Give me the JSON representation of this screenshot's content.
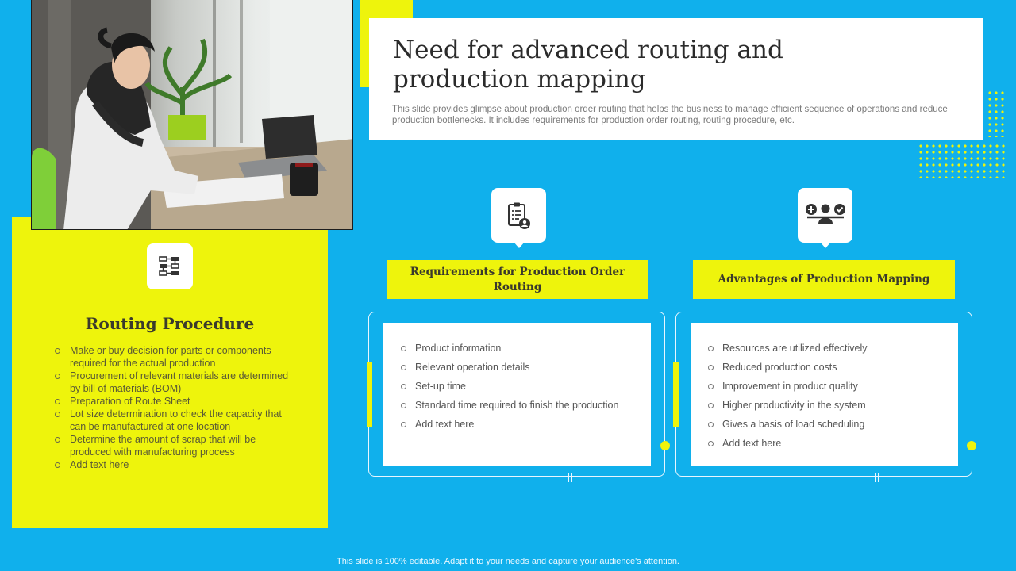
{
  "header": {
    "title": "Need for advanced routing and production mapping",
    "subtitle": "This slide provides glimpse about production order routing that helps the business to manage efficient sequence of operations and reduce production bottlenecks. It includes requirements for production order routing, routing procedure, etc."
  },
  "routing_procedure": {
    "title": "Routing Procedure",
    "icon": "flowchart-icon",
    "items": [
      "Make or buy decision for parts or components required for the actual production",
      "Procurement of relevant materials are determined by bill of materials (BOM)",
      "Preparation of Route Sheet",
      "Lot size determination to check the capacity that can be manufactured at one location",
      "Determine the amount of scrap that will be produced with manufacturing process",
      "Add text here"
    ]
  },
  "requirements": {
    "title": "Requirements for Production Order Routing",
    "icon": "checklist-user-icon",
    "items": [
      "Product information",
      "Relevant operation details",
      "Set-up time",
      "Standard time required to finish the production",
      "Add text here"
    ]
  },
  "advantages": {
    "title": "Advantages of Production Mapping",
    "icon": "person-pros-cons-icon",
    "items": [
      "Resources are utilized effectively",
      "Reduced production costs",
      "Improvement in product quality",
      "Higher productivity in the system",
      "Gives a basis of load scheduling",
      "Add text here"
    ]
  },
  "footer": {
    "text": "This slide is 100% editable. Adapt it to your needs and capture your audience's attention."
  },
  "colors": {
    "background": "#10b0ec",
    "accent_yellow": "#eef40c",
    "card_white": "#ffffff"
  }
}
